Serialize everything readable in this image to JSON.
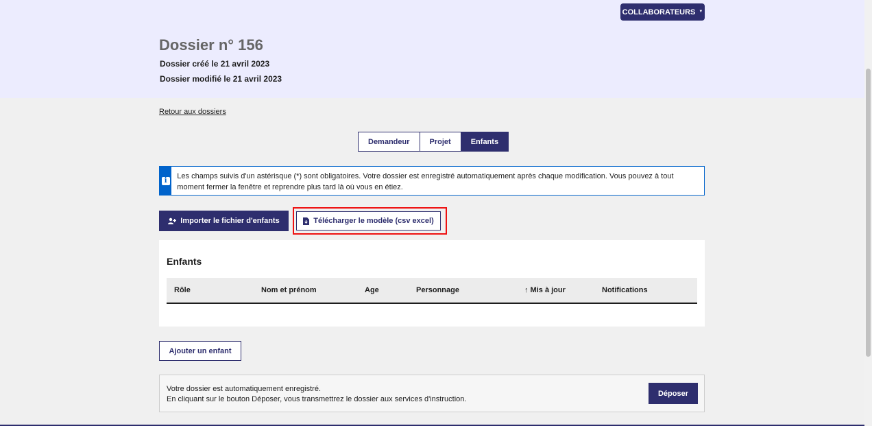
{
  "header": {
    "collab_label": "COLLABORATEURS",
    "title": "Dossier n° 156",
    "created": "Dossier créé le 21 avril 2023",
    "modified": "Dossier modifié le 21 avril 2023"
  },
  "nav": {
    "back_link": "Retour aux dossiers",
    "tabs": [
      {
        "label": "Demandeur"
      },
      {
        "label": "Projet"
      },
      {
        "label": "Enfants"
      }
    ]
  },
  "info": {
    "icon": "i",
    "text": "Les champs suivis d'un astérisque (*) sont obligatoires. Votre dossier est enregistré automatiquement après chaque modification. Vous pouvez à tout moment fermer la fenêtre et reprendre plus tard là où vous en étiez."
  },
  "actions": {
    "import_label": "Importer le fichier d'enfants",
    "download_label": "Télécharger le modèle (csv excel)",
    "add_label": "Ajouter un enfant"
  },
  "children": {
    "title": "Enfants",
    "columns": [
      "Rôle",
      "Nom et prénom",
      "Age",
      "Personnage",
      "↑ Mis à jour",
      "Notifications"
    ]
  },
  "footer": {
    "line1": "Votre dossier est automatiquement enregistré.",
    "line2": "En cliquant sur le bouton Déposer, vous transmettrez le dossier aux services d'instruction.",
    "submit_label": "Déposer"
  },
  "colors": {
    "primary": "#2e2e6e",
    "header_bg": "#ececfe",
    "info_blue": "#0063cb",
    "highlight_red": "#ee1111"
  }
}
